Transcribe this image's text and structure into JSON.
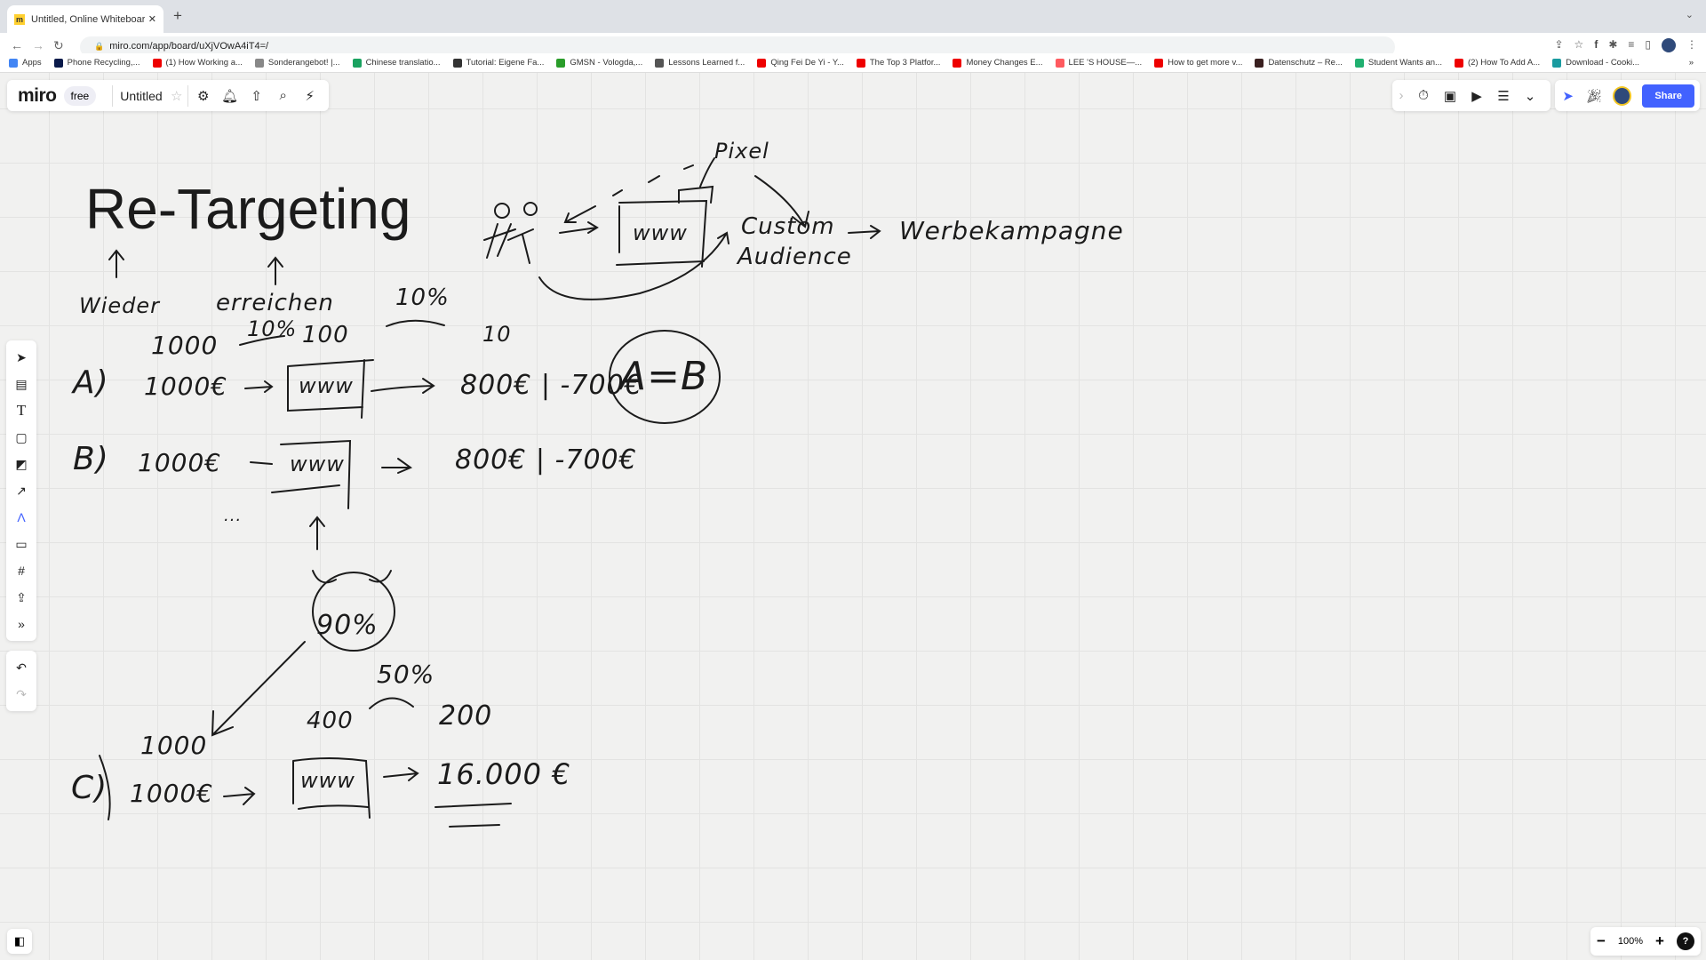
{
  "browser": {
    "tab_title": "Untitled, Online Whiteboard for",
    "new_tab": "+",
    "tab_menu": "⌄",
    "url": "miro.com/app/board/uXjVOwA4iT4=/",
    "bookmarks": [
      {
        "label": "Apps",
        "color": "#4285f4"
      },
      {
        "label": "Phone Recycling,...",
        "color": "#0a1a4a"
      },
      {
        "label": "(1) How Working a...",
        "color": "#e00"
      },
      {
        "label": "Sonderangebot! |...",
        "color": "#888"
      },
      {
        "label": "Chinese translatio...",
        "color": "#1aa260"
      },
      {
        "label": "Tutorial: Eigene Fa...",
        "color": "#333"
      },
      {
        "label": "GMSN - Vologda,...",
        "color": "#2a9d2a"
      },
      {
        "label": "Lessons Learned f...",
        "color": "#555"
      },
      {
        "label": "Qing Fei De Yi - Y...",
        "color": "#e00"
      },
      {
        "label": "The Top 3 Platfor...",
        "color": "#e00"
      },
      {
        "label": "Money Changes E...",
        "color": "#e00"
      },
      {
        "label": "LEE 'S HOUSE—...",
        "color": "#ff5a5f"
      },
      {
        "label": "How to get more v...",
        "color": "#e00"
      },
      {
        "label": "Datenschutz – Re...",
        "color": "#3a2020"
      },
      {
        "label": "Student Wants an...",
        "color": "#20b070"
      },
      {
        "label": "(2) How To Add A...",
        "color": "#e00"
      },
      {
        "label": "Download - Cooki...",
        "color": "#1a9ba0"
      }
    ],
    "bookmarks_more": "»"
  },
  "miro": {
    "logo": "miro",
    "plan_badge": "free",
    "board_name": "Untitled",
    "share_label": "Share",
    "zoom_level": "100%",
    "zoom_out": "−",
    "zoom_in": "+",
    "help": "?"
  },
  "board": {
    "title": "Re-Targeting",
    "notes": {
      "wieder": "Wieder",
      "erreichen": "erreichen",
      "pct10_top": "10%",
      "n1000_a": "1000",
      "pct10_a": "10%",
      "n100": "100",
      "n10": "10",
      "row_a_label": "A)",
      "row_a_budget": "1000€",
      "row_a_result": "800€ | -700€",
      "equality": "A=B",
      "row_b_label": "B)",
      "row_b_budget": "1000€",
      "row_b_result": "800€ | -700€",
      "dots": "...",
      "pct90": "90%",
      "n1000_c": "1000",
      "n400": "400",
      "pct50": "50%",
      "n200": "200",
      "row_c_label": "C)",
      "row_c_budget": "1000€",
      "row_c_result": "16.000 €",
      "www": "www",
      "pixel": "Pixel",
      "custom_audience_1": "Custom",
      "custom_audience_2": "Audience",
      "campaign": "Werbekampagne"
    }
  }
}
